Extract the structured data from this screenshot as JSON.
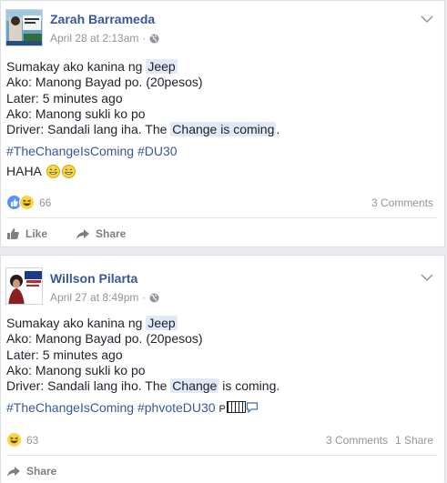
{
  "posts": [
    {
      "author": "Zarah Barrameda",
      "time": "April 28 at 2:13am",
      "lines": [
        {
          "plain": "Sumakay ako kanina ng ",
          "highlight": "Jeep",
          "after": ""
        },
        {
          "plain": "Ako: Manong Bayad po. (20pesos)",
          "highlight": "",
          "after": ""
        },
        {
          "plain": "Later: 5 minutes ago",
          "highlight": "",
          "after": ""
        },
        {
          "plain": "Ako: Manong sukli ko po",
          "highlight": "",
          "after": ""
        },
        {
          "plain": "Driver: Sandali lang iha. The ",
          "highlight": "Change is coming",
          "after": "."
        }
      ],
      "hashtags": [
        "#TheChangeIsComing",
        "#DU30"
      ],
      "haha_text": "HAHA",
      "reaction_count": "66",
      "comments": "3 Comments",
      "shares": "",
      "actions": {
        "like": "Like",
        "share": "Share"
      }
    },
    {
      "author": "Willson Pilarta",
      "time": "April 27 at 8:49pm",
      "lines": [
        {
          "plain": "Sumakay ako kanina ng ",
          "highlight": "Jeep",
          "after": ""
        },
        {
          "plain": "Ako: Manong Bayad po. (20pesos)",
          "highlight": "",
          "after": ""
        },
        {
          "plain": "Later: 5 minutes ago",
          "highlight": "",
          "after": ""
        },
        {
          "plain": "Ako: Manong sukli ko po",
          "highlight": "",
          "after": ""
        },
        {
          "plain": "Driver: Sandali lang iho. The ",
          "highlight": "Change",
          "after": " is coming."
        }
      ],
      "hashtags": [
        "#TheChangeIsComing",
        "#phvoteDU30"
      ],
      "hashtag_suffix": "P",
      "reaction_count": "63",
      "comments": "3 Comments",
      "shares": "1 Share",
      "actions": {
        "share": "Share"
      }
    }
  ],
  "colors": {
    "link": "#365899",
    "meta": "#90949c",
    "highlight": "#e1e9f6",
    "like_blue": "#5890ff",
    "haha_yellow": "#f7d543"
  }
}
